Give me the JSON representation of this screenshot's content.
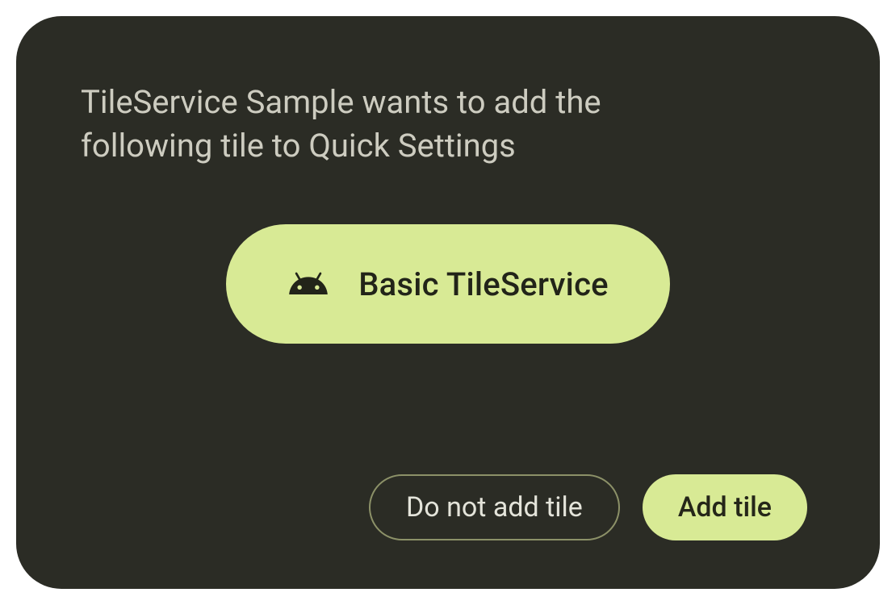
{
  "dialog": {
    "message": "TileService Sample wants to add the following tile to Quick Settings",
    "tile": {
      "icon_name": "android-icon",
      "label": "Basic TileService"
    },
    "actions": {
      "decline_label": "Do not add tile",
      "accept_label": "Add tile"
    }
  },
  "colors": {
    "dialog_bg": "#2b2c25",
    "accent": "#d8ea95",
    "text_muted": "#cdccc0",
    "text_on_accent": "#222419",
    "outline_border": "#8c9168"
  }
}
